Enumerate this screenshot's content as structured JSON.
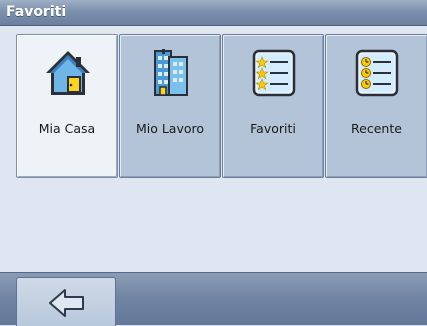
{
  "window": {
    "title": "Favoriti"
  },
  "tiles": [
    {
      "label": "Mia Casa",
      "icon": "home-icon",
      "selected": true
    },
    {
      "label": "Mio Lavoro",
      "icon": "office-building-icon",
      "selected": false
    },
    {
      "label": "Favoriti",
      "icon": "starred-list-icon",
      "selected": false
    },
    {
      "label": "Recente",
      "icon": "recent-list-icon",
      "selected": false
    }
  ],
  "bottom_bar": {
    "back_icon": "back-arrow-icon"
  },
  "colors": {
    "title_bar": "#7b90ad",
    "tile_normal": "#b3c4d8",
    "tile_selected": "#eef3f8",
    "content_bg": "#dfe6f1"
  }
}
